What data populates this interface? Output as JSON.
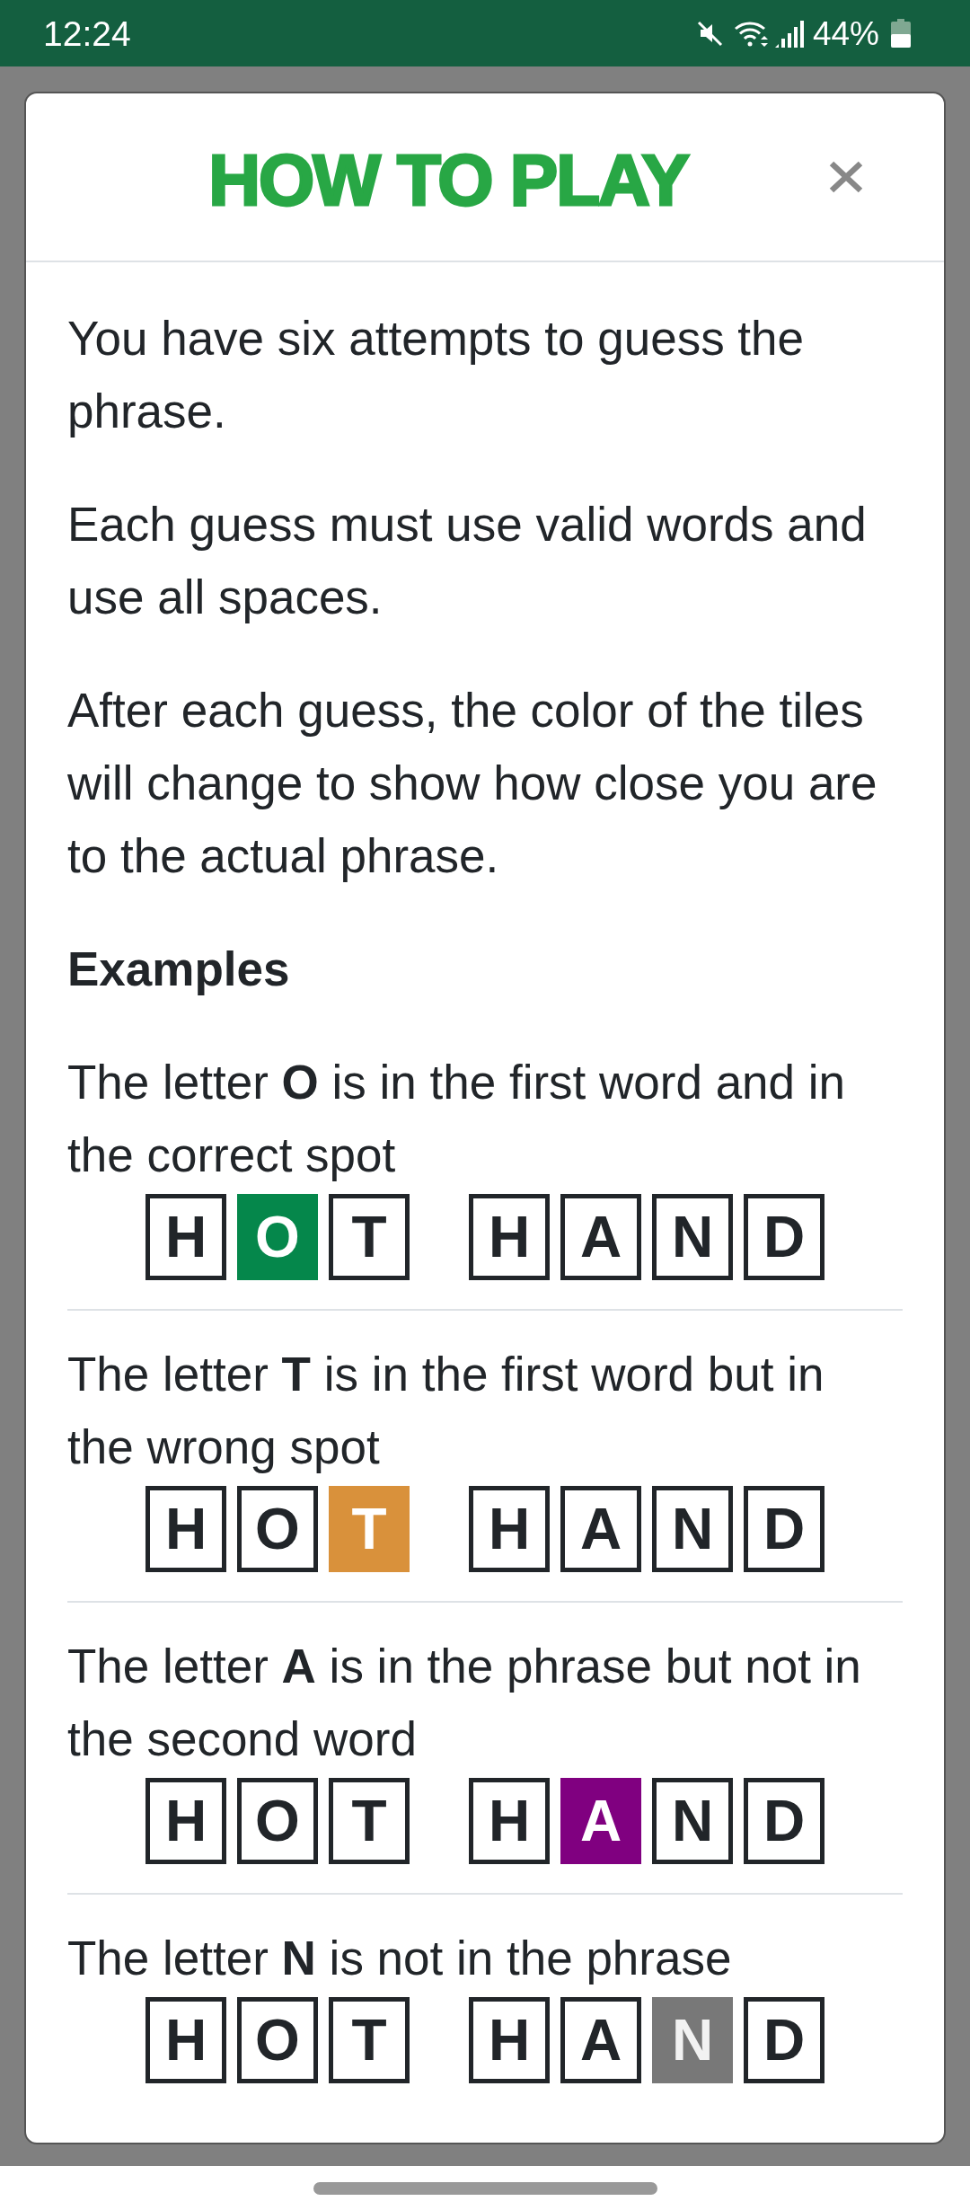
{
  "status_bar": {
    "time": "12:24",
    "battery_percent": "44%"
  },
  "dialog": {
    "title": "HOW TO PLAY",
    "paragraphs": [
      "You have six attempts to guess the phrase.",
      "Each guess must use valid words and use all spaces.",
      "After each guess, the color of the tiles will change to show how close you are to the actual phrase."
    ],
    "examples_heading": "Examples",
    "examples": [
      {
        "description": "The letter **O** is in the first word and in the correct spot",
        "words": [
          {
            "tiles": [
              {
                "letter": "H",
                "kind": "plain"
              },
              {
                "letter": "O",
                "kind": "correct"
              },
              {
                "letter": "T",
                "kind": "plain"
              }
            ]
          },
          {
            "tiles": [
              {
                "letter": "H",
                "kind": "plain"
              },
              {
                "letter": "A",
                "kind": "plain"
              },
              {
                "letter": "N",
                "kind": "plain"
              },
              {
                "letter": "D",
                "kind": "plain"
              }
            ]
          }
        ]
      },
      {
        "description": "The letter **T** is in the first word but in the wrong spot",
        "words": [
          {
            "tiles": [
              {
                "letter": "H",
                "kind": "plain"
              },
              {
                "letter": "O",
                "kind": "plain"
              },
              {
                "letter": "T",
                "kind": "misplaced"
              }
            ]
          },
          {
            "tiles": [
              {
                "letter": "H",
                "kind": "plain"
              },
              {
                "letter": "A",
                "kind": "plain"
              },
              {
                "letter": "N",
                "kind": "plain"
              },
              {
                "letter": "D",
                "kind": "plain"
              }
            ]
          }
        ]
      },
      {
        "description": "The letter **A** is in the phrase but not in the second word",
        "words": [
          {
            "tiles": [
              {
                "letter": "H",
                "kind": "plain"
              },
              {
                "letter": "O",
                "kind": "plain"
              },
              {
                "letter": "T",
                "kind": "plain"
              }
            ]
          },
          {
            "tiles": [
              {
                "letter": "H",
                "kind": "plain"
              },
              {
                "letter": "A",
                "kind": "elsewhere"
              },
              {
                "letter": "N",
                "kind": "plain"
              },
              {
                "letter": "D",
                "kind": "plain"
              }
            ]
          }
        ]
      },
      {
        "description": "The letter **N** is not in the phrase",
        "words": [
          {
            "tiles": [
              {
                "letter": "H",
                "kind": "plain"
              },
              {
                "letter": "O",
                "kind": "plain"
              },
              {
                "letter": "T",
                "kind": "plain"
              }
            ]
          },
          {
            "tiles": [
              {
                "letter": "H",
                "kind": "plain"
              },
              {
                "letter": "A",
                "kind": "plain"
              },
              {
                "letter": "N",
                "kind": "absent"
              },
              {
                "letter": "D",
                "kind": "plain"
              }
            ]
          }
        ]
      }
    ]
  }
}
